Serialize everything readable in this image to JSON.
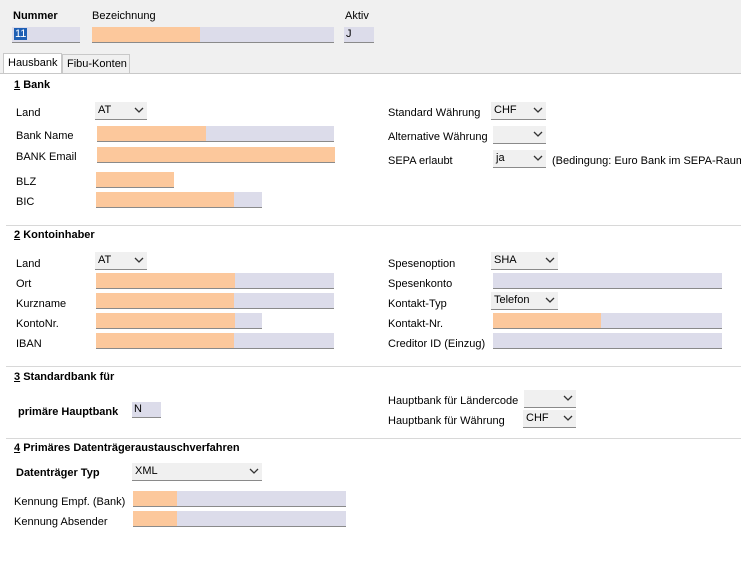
{
  "header": {
    "nummer_label": "Nummer",
    "nummer_value": "11",
    "bezeichnung_label": "Bezeichnung",
    "bezeichnung_value": "",
    "aktiv_label": "Aktiv",
    "aktiv_value": "J"
  },
  "tabs": [
    {
      "label": "Hausbank",
      "active": true
    },
    {
      "label": "Fibu-Konten",
      "active": false
    }
  ],
  "bank": {
    "section_number": "1",
    "section_title": "Bank",
    "land_label": "Land",
    "land_value": "AT",
    "bank_name_label": "Bank Name",
    "bank_email_label": "BANK Email",
    "blz_label": "BLZ",
    "bic_label": "BIC",
    "standard_waehrung_label": "Standard Währung",
    "standard_waehrung_value": "CHF",
    "alternative_waehrung_label": "Alternative Währung",
    "alternative_waehrung_value": "",
    "sepa_label": "SEPA erlaubt",
    "sepa_value": "ja",
    "sepa_hint": "(Bedingung: Euro Bank im SEPA-Raum)"
  },
  "kontoinhaber": {
    "section_number": "2",
    "section_title": "Kontoinhaber",
    "land_label": "Land",
    "land_value": "AT",
    "ort_label": "Ort",
    "kurzname_label": "Kurzname",
    "kontonr_label": "KontoNr.",
    "iban_label": "IBAN",
    "spesenoption_label": "Spesenoption",
    "spesenoption_value": "SHA",
    "spesenkonto_label": "Spesenkonto",
    "kontakt_typ_label": "Kontakt-Typ",
    "kontakt_typ_value": "Telefon",
    "kontakt_nr_label": "Kontakt-Nr.",
    "creditor_id_label": "Creditor ID (Einzug)"
  },
  "standardbank": {
    "section_number": "3",
    "section_title": "Standardbank für",
    "primaere_label": "primäre Hauptbank",
    "primaere_value": "N",
    "laendercode_label": "Hauptbank für Ländercode",
    "laendercode_value": "",
    "waehrung_label": "Hauptbank für Währung",
    "waehrung_value": "CHF"
  },
  "dta": {
    "section_number": "4",
    "section_title": "Primäres Datenträgeraustauschverfahren",
    "typ_label": "Datenträger Typ",
    "typ_value": "XML",
    "kennung_empf_label": "Kennung Empf. (Bank)",
    "kennung_absender_label": "Kennung Absender"
  },
  "colors": {
    "required_fill": "#fcc89c",
    "field_bg": "#dcdcea",
    "selection": "#1e5fb4"
  },
  "icons": {
    "dropdown": "chevron-down-icon"
  }
}
